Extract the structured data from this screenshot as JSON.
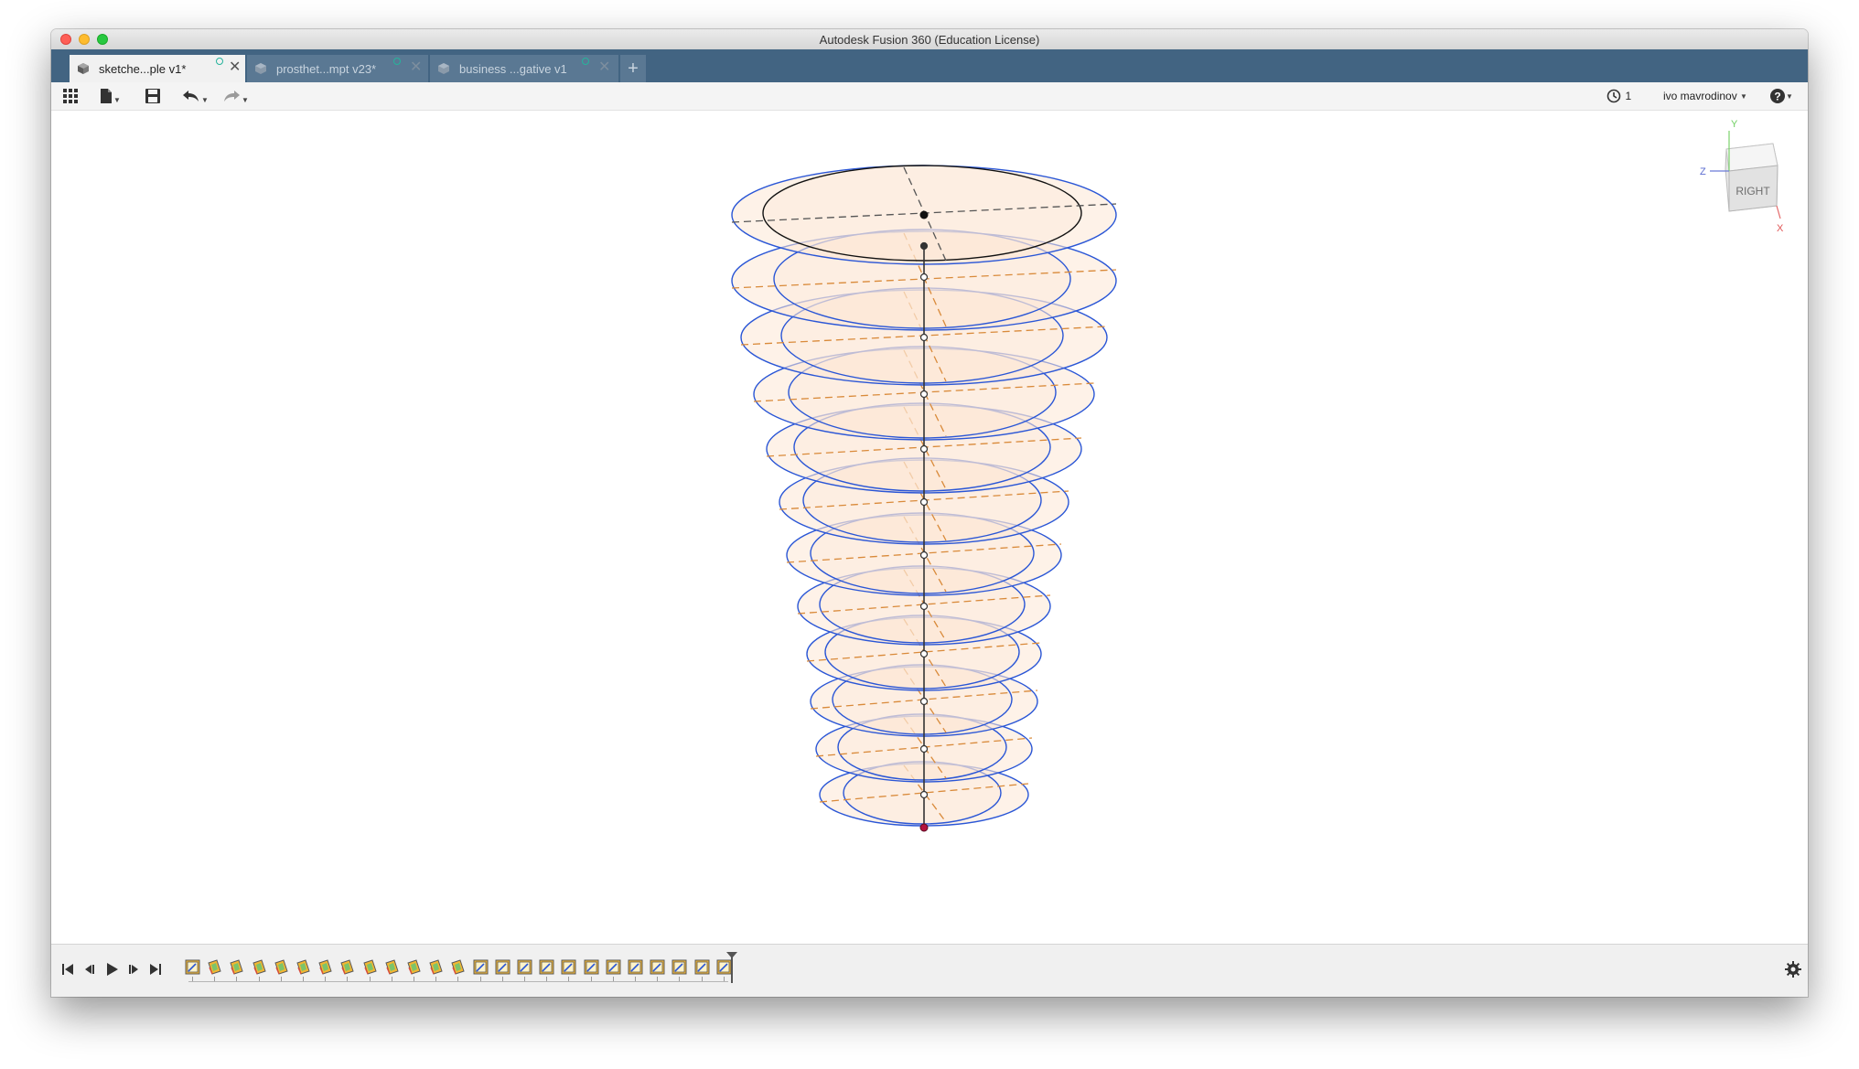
{
  "window": {
    "title": "Autodesk Fusion 360 (Education License)"
  },
  "tabs": [
    {
      "label": "sketche...ple v1*",
      "active": true
    },
    {
      "label": "prosthet...mpt v23*",
      "active": false
    },
    {
      "label": "business ...gative v1",
      "active": false
    }
  ],
  "toolbar": {
    "data_panel_icon": "grid-icon",
    "file_icon": "file-icon",
    "save_icon": "save-icon",
    "undo_icon": "undo-icon",
    "redo_icon": "redo-icon",
    "job_status_count": "1",
    "user_name": "ivo mavrodinov",
    "help_icon": "help-icon"
  },
  "viewcube": {
    "face_label": "RIGHT",
    "axis_y": "Y",
    "axis_z": "Z",
    "axis_x": "X"
  },
  "timeline": {
    "controls": [
      "go-to-start",
      "step-back",
      "play",
      "step-forward",
      "go-to-end"
    ],
    "features": [
      "sketch",
      "plane",
      "plane",
      "plane",
      "plane",
      "plane",
      "plane",
      "plane",
      "plane",
      "plane",
      "plane",
      "plane",
      "plane",
      "sketch",
      "sketch",
      "sketch",
      "sketch",
      "sketch",
      "sketch",
      "sketch",
      "sketch",
      "sketch",
      "sketch",
      "sketch",
      "sketch"
    ]
  },
  "colors": {
    "tab_bar": "#426482",
    "sketch_curve": "#2a56d6",
    "construction_line": "#d98a3a",
    "profile_fill": "#fde7d6"
  }
}
